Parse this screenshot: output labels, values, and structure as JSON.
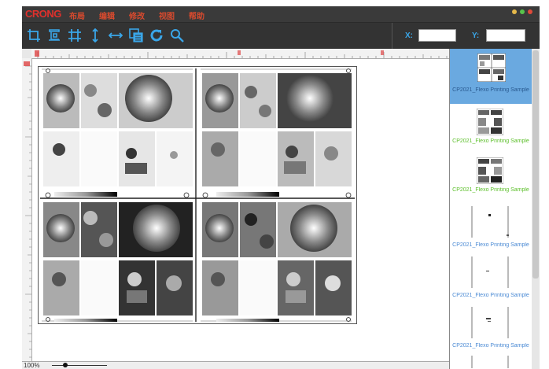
{
  "app": {
    "brand": "CRONG"
  },
  "menu": [
    "布局",
    "编辑",
    "修改",
    "视图",
    "帮助"
  ],
  "window_controls": {
    "colors": [
      "#e5b84a",
      "#58c34b",
      "#e04a3a"
    ]
  },
  "toolbar": {
    "tools": [
      "crop-frame-icon",
      "crop-bleed-icon",
      "crop-marks-icon",
      "vertical-split-icon",
      "horizontal-split-icon",
      "copy-layer-icon",
      "refresh-icon",
      "search-icon"
    ],
    "x_label": "X:",
    "x_value": "",
    "y_label": "Y:",
    "y_value": ""
  },
  "statusbar": {
    "zoom": "100%",
    "zoom_fraction": 0.2
  },
  "thumbnails": [
    {
      "label": "CP2021_Flexo Printing Sample",
      "selected": true
    },
    {
      "label": "CP2021_Flexo Printing Sample",
      "selected": false
    },
    {
      "label": "CP2021_Flexo Printing Sample",
      "selected": false
    },
    {
      "label": "CP2021_Flexo Printing Sample",
      "selected": false
    },
    {
      "label": "CP2021_Flexo Printing Sample",
      "selected": false
    },
    {
      "label": "CP2021_Flexo Printing Sample",
      "selected": false
    }
  ],
  "colors": {
    "accent": "#3aa6e8",
    "brand": "#e0302c",
    "label_green": "#5cbf2a",
    "label_blue": "#4a8ad4",
    "selected_bg": "#6aa9e0"
  }
}
